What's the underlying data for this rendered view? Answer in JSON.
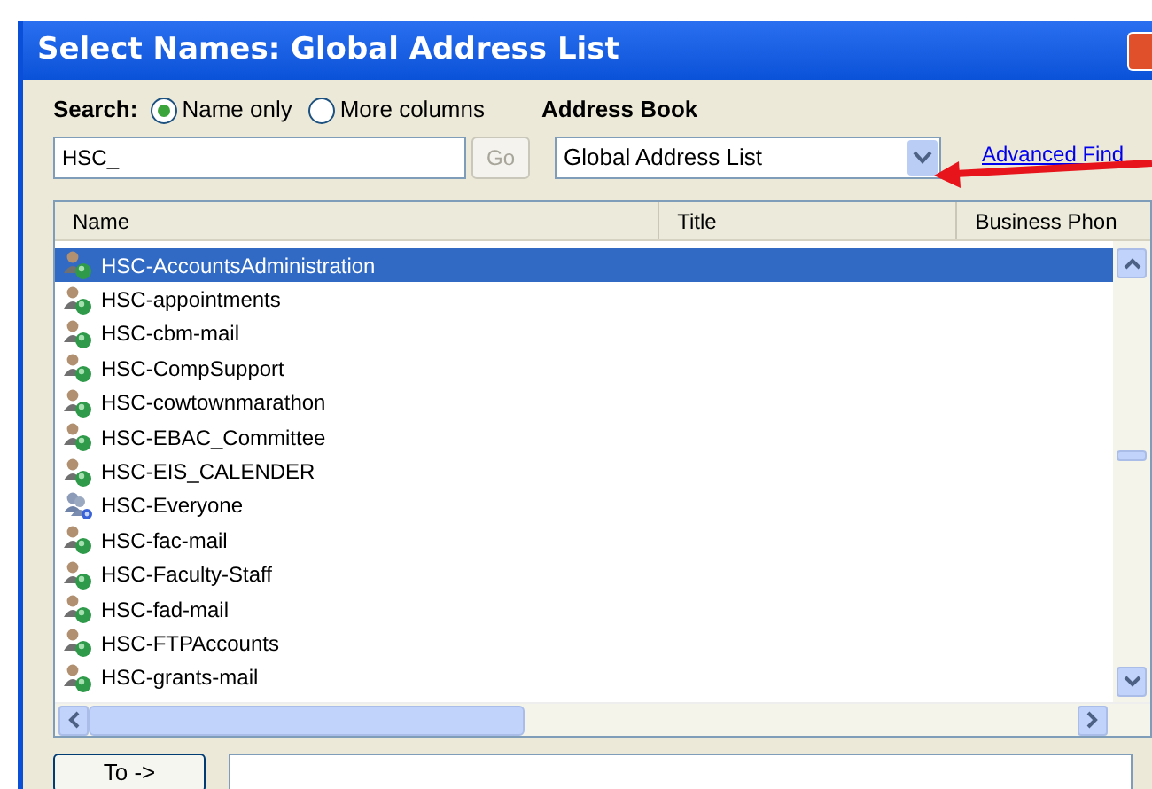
{
  "window": {
    "title": "Select Names: Global Address List"
  },
  "search": {
    "label": "Search:",
    "options": [
      {
        "label": "Name only",
        "selected": true
      },
      {
        "label": "More columns",
        "selected": false
      }
    ],
    "query": "HSC_"
  },
  "go_button": {
    "label": "Go",
    "disabled": true
  },
  "address_book": {
    "label": "Address Book",
    "value": "Global Address List"
  },
  "advanced_find": "Advanced Find",
  "table": {
    "columns": [
      "Name",
      "Title",
      "Business Phon"
    ],
    "rows": [
      {
        "name": "HSC-AccountsAdministration",
        "kind": "list",
        "selected": true
      },
      {
        "name": "HSC-appointments",
        "kind": "list",
        "selected": false
      },
      {
        "name": "HSC-cbm-mail",
        "kind": "list",
        "selected": false
      },
      {
        "name": "HSC-CompSupport",
        "kind": "list",
        "selected": false
      },
      {
        "name": "HSC-cowtownmarathon",
        "kind": "list",
        "selected": false
      },
      {
        "name": "HSC-EBAC_Committee",
        "kind": "list",
        "selected": false
      },
      {
        "name": "HSC-EIS_CALENDER",
        "kind": "list",
        "selected": false
      },
      {
        "name": "HSC-Everyone",
        "kind": "group",
        "selected": false
      },
      {
        "name": "HSC-fac-mail",
        "kind": "list",
        "selected": false
      },
      {
        "name": "HSC-Faculty-Staff",
        "kind": "list",
        "selected": false
      },
      {
        "name": "HSC-fad-mail",
        "kind": "list",
        "selected": false
      },
      {
        "name": "HSC-FTPAccounts",
        "kind": "list",
        "selected": false
      },
      {
        "name": "HSC-grants-mail",
        "kind": "list",
        "selected": false
      }
    ]
  },
  "to_button": "To ->"
}
